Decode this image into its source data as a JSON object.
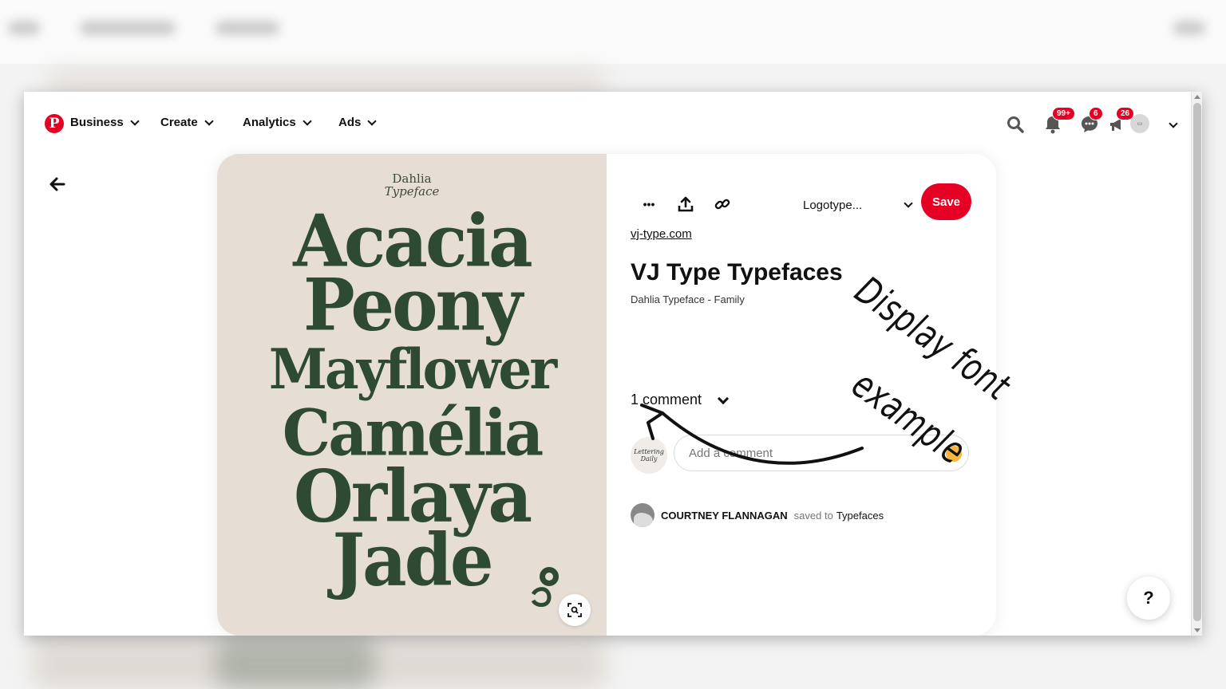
{
  "nav": {
    "logo": "P",
    "menus": [
      {
        "label": "Business"
      },
      {
        "label": "Create"
      },
      {
        "label": "Analytics"
      },
      {
        "label": "Ads"
      }
    ],
    "notifications_badge": "99+",
    "messages_badge": "6",
    "updates_badge": "26"
  },
  "pin_image": {
    "brand_line1": "Dahlia",
    "brand_line2": "Typeface",
    "words": [
      "Acacia",
      "Peony",
      "Mayflower",
      "Camélia",
      "Orlaya",
      "Jade"
    ]
  },
  "toolbar": {
    "more_label": "•••",
    "board_select": "Logotype...",
    "save_label": "Save"
  },
  "pin": {
    "link": "vj-type.com",
    "title": "VJ Type Typefaces",
    "description": "Dahlia Typeface - Family"
  },
  "comments": {
    "count_label": "1 comment",
    "input_placeholder": "Add a comment",
    "avatar_text": "Lettering Daily"
  },
  "saved_by": {
    "user": "COURTNEY FLANNAGAN",
    "middle": "saved to",
    "board": "Typefaces"
  },
  "help_label": "?",
  "annotation": {
    "line1": "Display font",
    "line2": "example"
  }
}
